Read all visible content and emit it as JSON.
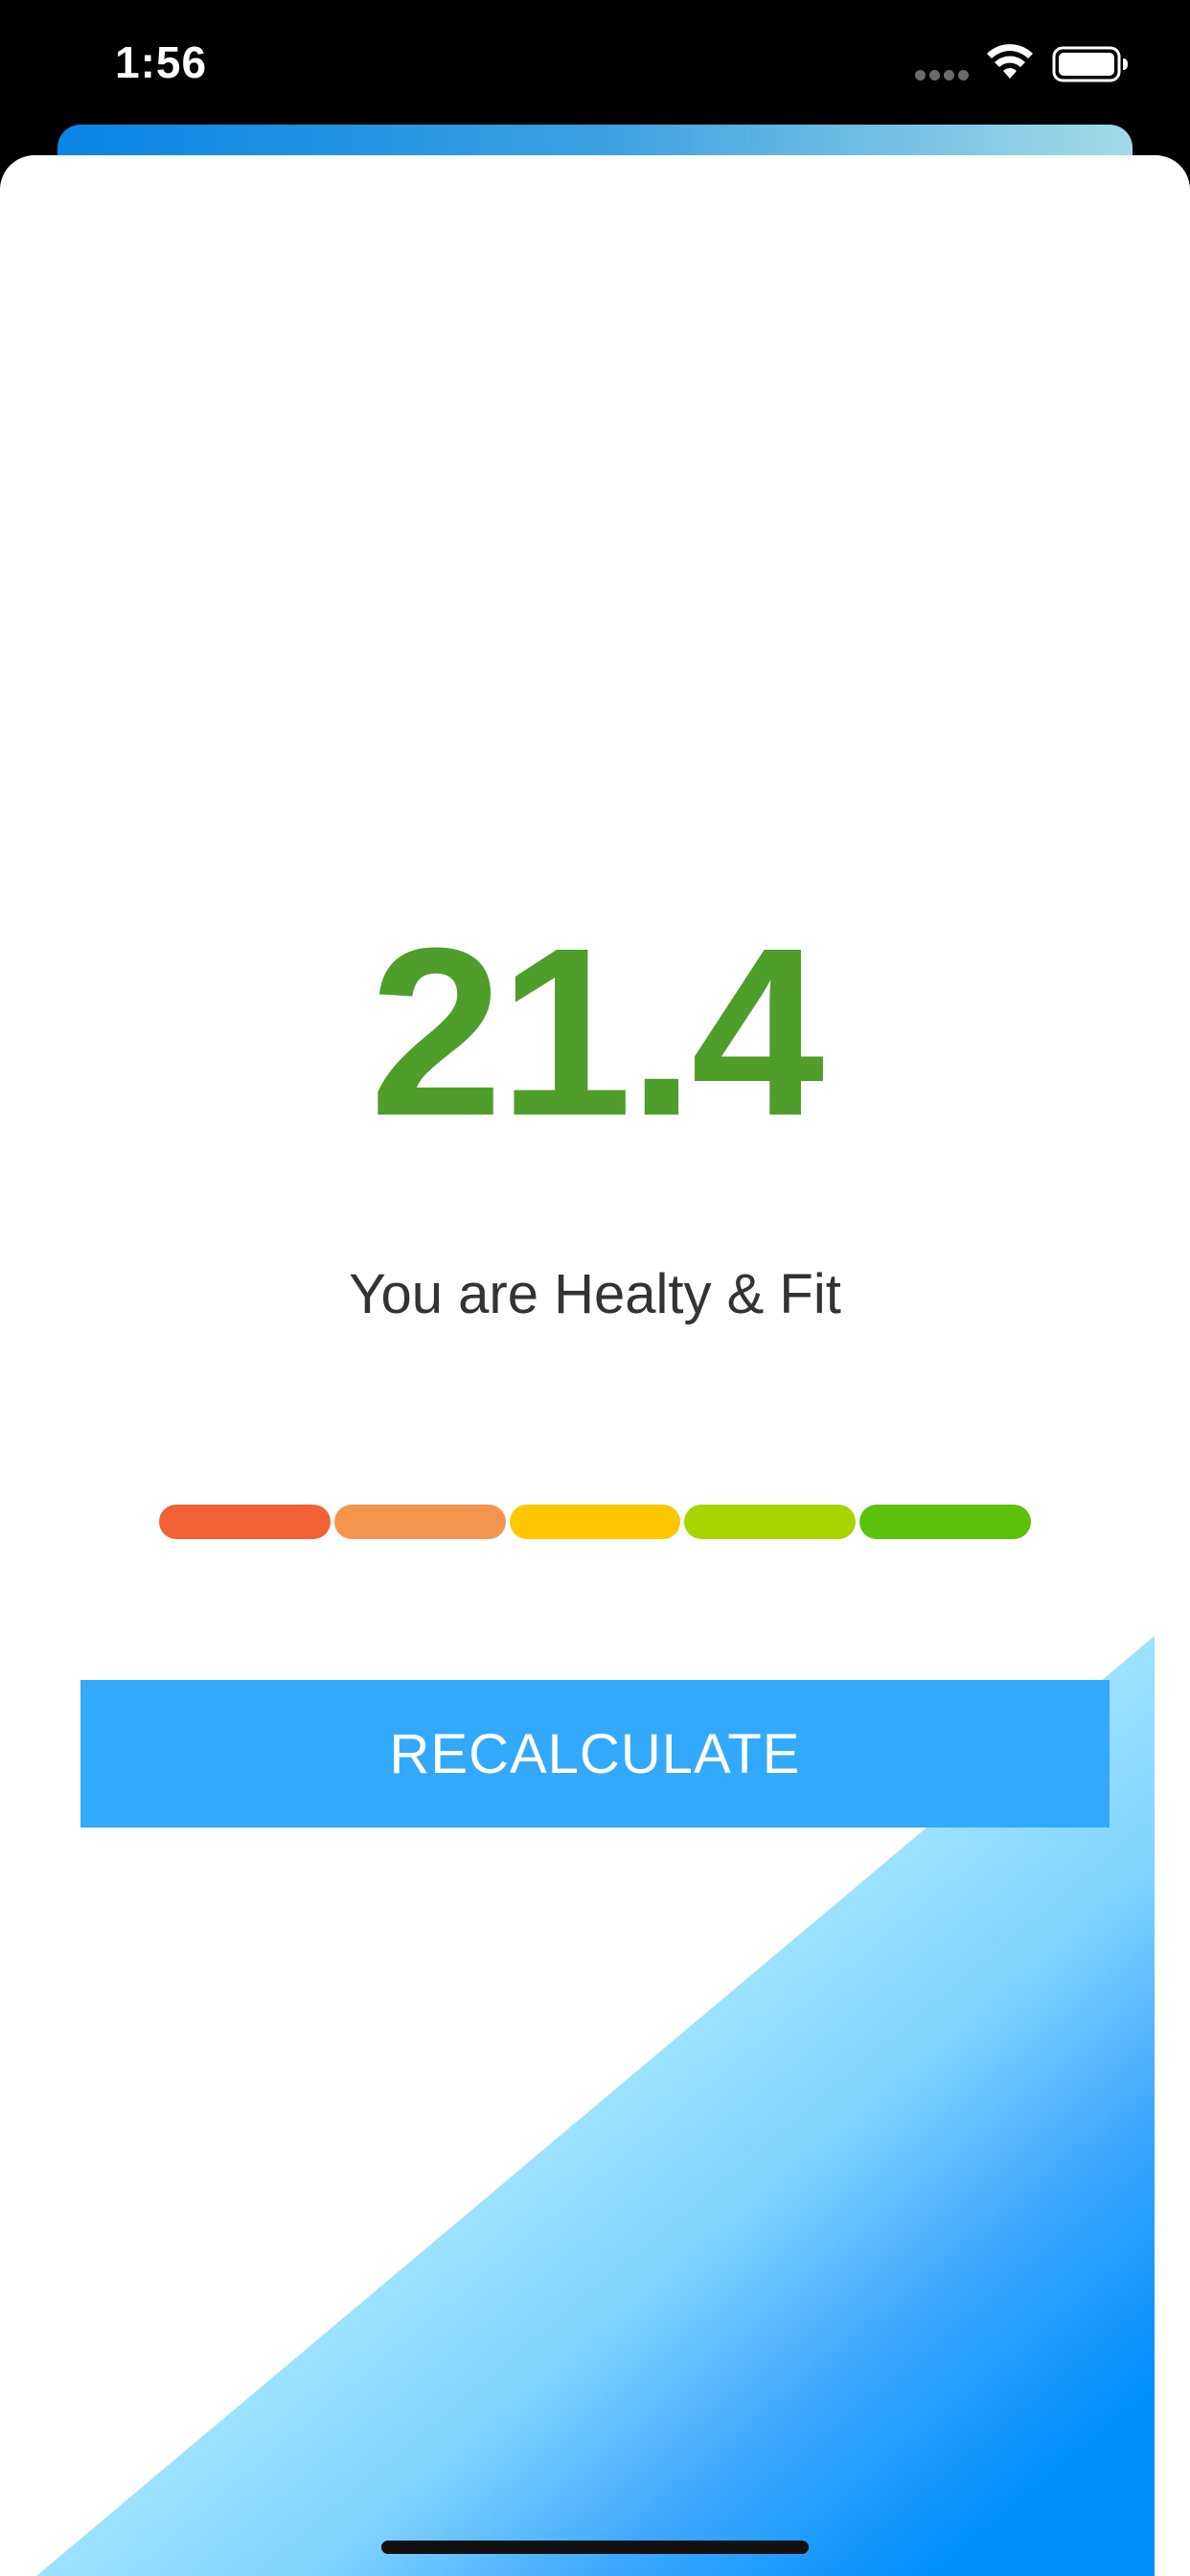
{
  "status_bar": {
    "time": "1:56",
    "icons": [
      "signal-dots-icon",
      "wifi-icon",
      "battery-icon"
    ]
  },
  "result": {
    "bmi_value": "21.4",
    "message": "You are Healty & Fit",
    "value_color": "#4f9e2b"
  },
  "scale": {
    "segments": [
      {
        "color": "#f26135"
      },
      {
        "color": "#f5954d"
      },
      {
        "color": "#ffc700"
      },
      {
        "color": "#a9d400"
      },
      {
        "color": "#5bc10a"
      }
    ]
  },
  "actions": {
    "recalculate_label": "RECALCULATE",
    "button_color": "#33a9fc"
  },
  "colors": {
    "header_gradient_start": "#0a84e6",
    "header_gradient_end": "#a3dbe6",
    "wedge_light": "#b3efff",
    "wedge_dark": "#008ffd"
  }
}
